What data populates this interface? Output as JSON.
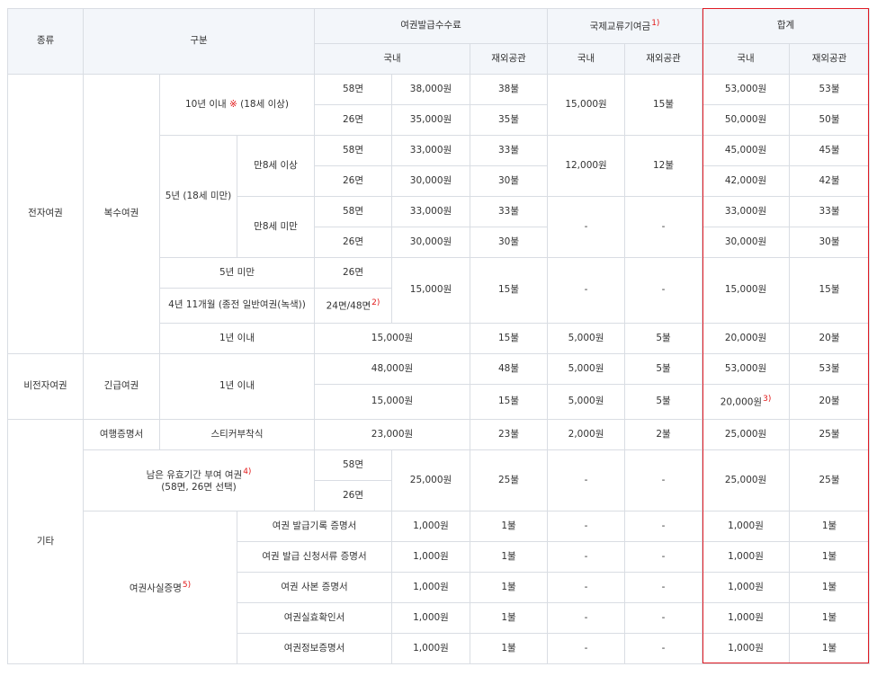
{
  "header": {
    "type": "종류",
    "category": "구분",
    "issue_fee": "여권발급수수료",
    "intl_fund": "국제교류기여금",
    "intl_fund_note": "1)",
    "total": "합계",
    "domestic": "국내",
    "overseas": "재외공관"
  },
  "types": {
    "electronic": "전자여권",
    "non_electronic": "비전자여권",
    "other": "기타"
  },
  "sub": {
    "multiple": "복수여권",
    "emergency": "긴급여권",
    "travel_cert": "여행증명서",
    "remaining": "남은 유효기간 부여 여권",
    "remaining_note": "4)",
    "remaining_sub": "(58면, 26면 선택)",
    "fact_cert": "여권사실증명",
    "fact_cert_note": "5)"
  },
  "validity": {
    "ten_year_a": "10년 이내 ",
    "ten_year_mark": "※",
    "ten_year_b": " (18세 이상)",
    "five_year": "5년 (18세 미만)",
    "age8_over": "만8세 이상",
    "age8_under": "만8세 미만",
    "under5": "5년 미만",
    "four_year": "4년 11개월 (종전 일반여권(녹색))",
    "one_year": "1년 이내",
    "emergency_one_year": "1년 이내",
    "sticker": "스티커부착식"
  },
  "pages": {
    "p58": "58면",
    "p26": "26면",
    "p24_48": "24면/48면",
    "p24_48_note": "2)"
  },
  "fact_items": [
    "여권 발급기록 증명서",
    "여권 발급 신청서류 증명서",
    "여권 사본 증명서",
    "여권실효확인서",
    "여권정보증명서"
  ],
  "values": {
    "k38000": "38,000원",
    "d38": "38불",
    "k35000": "35,000원",
    "d35": "35불",
    "k15000": "15,000원",
    "d15": "15불",
    "k53000": "53,000원",
    "d53": "53불",
    "k50000": "50,000원",
    "d50": "50불",
    "k33000": "33,000원",
    "d33": "33불",
    "k30000": "30,000원",
    "d30": "30불",
    "k12000": "12,000원",
    "d12": "12불",
    "k45000": "45,000원",
    "d45": "45불",
    "k42000": "42,000원",
    "d42": "42불",
    "k5000": "5,000원",
    "d5": "5불",
    "k20000": "20,000원",
    "d20": "20불",
    "k48000": "48,000원",
    "d48": "48불",
    "total_note3": "3)",
    "k23000": "23,000원",
    "d23": "23불",
    "k2000": "2,000원",
    "d2": "2불",
    "k25000": "25,000원",
    "d25": "25불",
    "k1000": "1,000원",
    "d1": "1불",
    "dash": "-"
  }
}
